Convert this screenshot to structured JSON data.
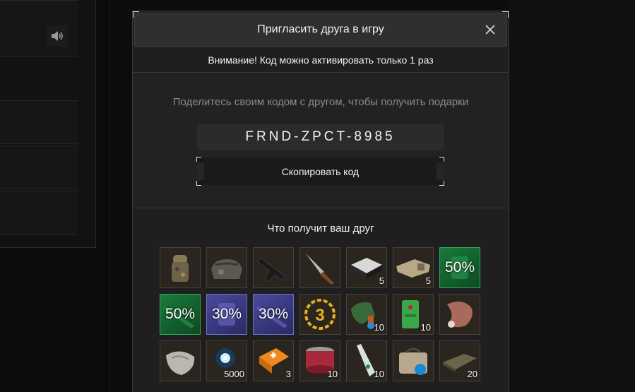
{
  "modal": {
    "title": "Пригласить друга в игру",
    "warning": "Внимание! Код можно активировать только 1 раз",
    "share_text": "Поделитесь своим кодом с другом, чтобы получить подарки",
    "code": "FRND-ZPCT-8985",
    "copy_button": "Скопировать код",
    "rewards_title": "Что получит ваш друг"
  },
  "colors": {
    "modal_bg": "#1f1f1f",
    "header_bg": "#2f2f2f",
    "green_tier": "#1a7a3c",
    "purple_tier": "#4a4a9c",
    "item_bg": "#2a251e"
  },
  "items": [
    {
      "icon": "camo-armor-icon",
      "qty": "",
      "pct": "",
      "tier": "normal"
    },
    {
      "icon": "camo-bag-icon",
      "qty": "",
      "pct": "",
      "tier": "normal"
    },
    {
      "icon": "pistol-icon",
      "qty": "",
      "pct": "",
      "tier": "normal"
    },
    {
      "icon": "knife-icon",
      "qty": "",
      "pct": "",
      "tier": "normal"
    },
    {
      "icon": "ammo-box-icon",
      "qty": "5",
      "pct": "",
      "tier": "normal"
    },
    {
      "icon": "bandage-pack-icon",
      "qty": "5",
      "pct": "",
      "tier": "normal"
    },
    {
      "icon": "armor-discount-icon",
      "qty": "",
      "pct": "50%",
      "tier": "green"
    },
    {
      "icon": "weapon-discount-icon",
      "qty": "",
      "pct": "50%",
      "tier": "green"
    },
    {
      "icon": "armor-discount-icon",
      "qty": "",
      "pct": "30%",
      "tier": "purple"
    },
    {
      "icon": "weapon-discount-icon",
      "qty": "",
      "pct": "30%",
      "tier": "purple"
    },
    {
      "icon": "level-3-badge-icon",
      "qty": "",
      "pct": "",
      "tier": "normal"
    },
    {
      "icon": "green-medkit-icon",
      "qty": "10",
      "pct": "",
      "tier": "normal"
    },
    {
      "icon": "green-first-aid-icon",
      "qty": "10",
      "pct": "",
      "tier": "normal"
    },
    {
      "icon": "meat-icon",
      "qty": "",
      "pct": "",
      "tier": "normal"
    },
    {
      "icon": "cash-roll-icon",
      "qty": "",
      "pct": "",
      "tier": "normal"
    },
    {
      "icon": "energy-orb-icon",
      "qty": "5000",
      "pct": "",
      "tier": "normal"
    },
    {
      "icon": "orange-medkit-icon",
      "qty": "3",
      "pct": "",
      "tier": "normal"
    },
    {
      "icon": "canned-food-icon",
      "qty": "10",
      "pct": "",
      "tier": "normal"
    },
    {
      "icon": "water-bottle-icon",
      "qty": "10",
      "pct": "",
      "tier": "normal"
    },
    {
      "icon": "medical-bag-icon",
      "qty": "",
      "pct": "",
      "tier": "normal"
    },
    {
      "icon": "ration-bar-icon",
      "qty": "20",
      "pct": "",
      "tier": "normal"
    }
  ]
}
